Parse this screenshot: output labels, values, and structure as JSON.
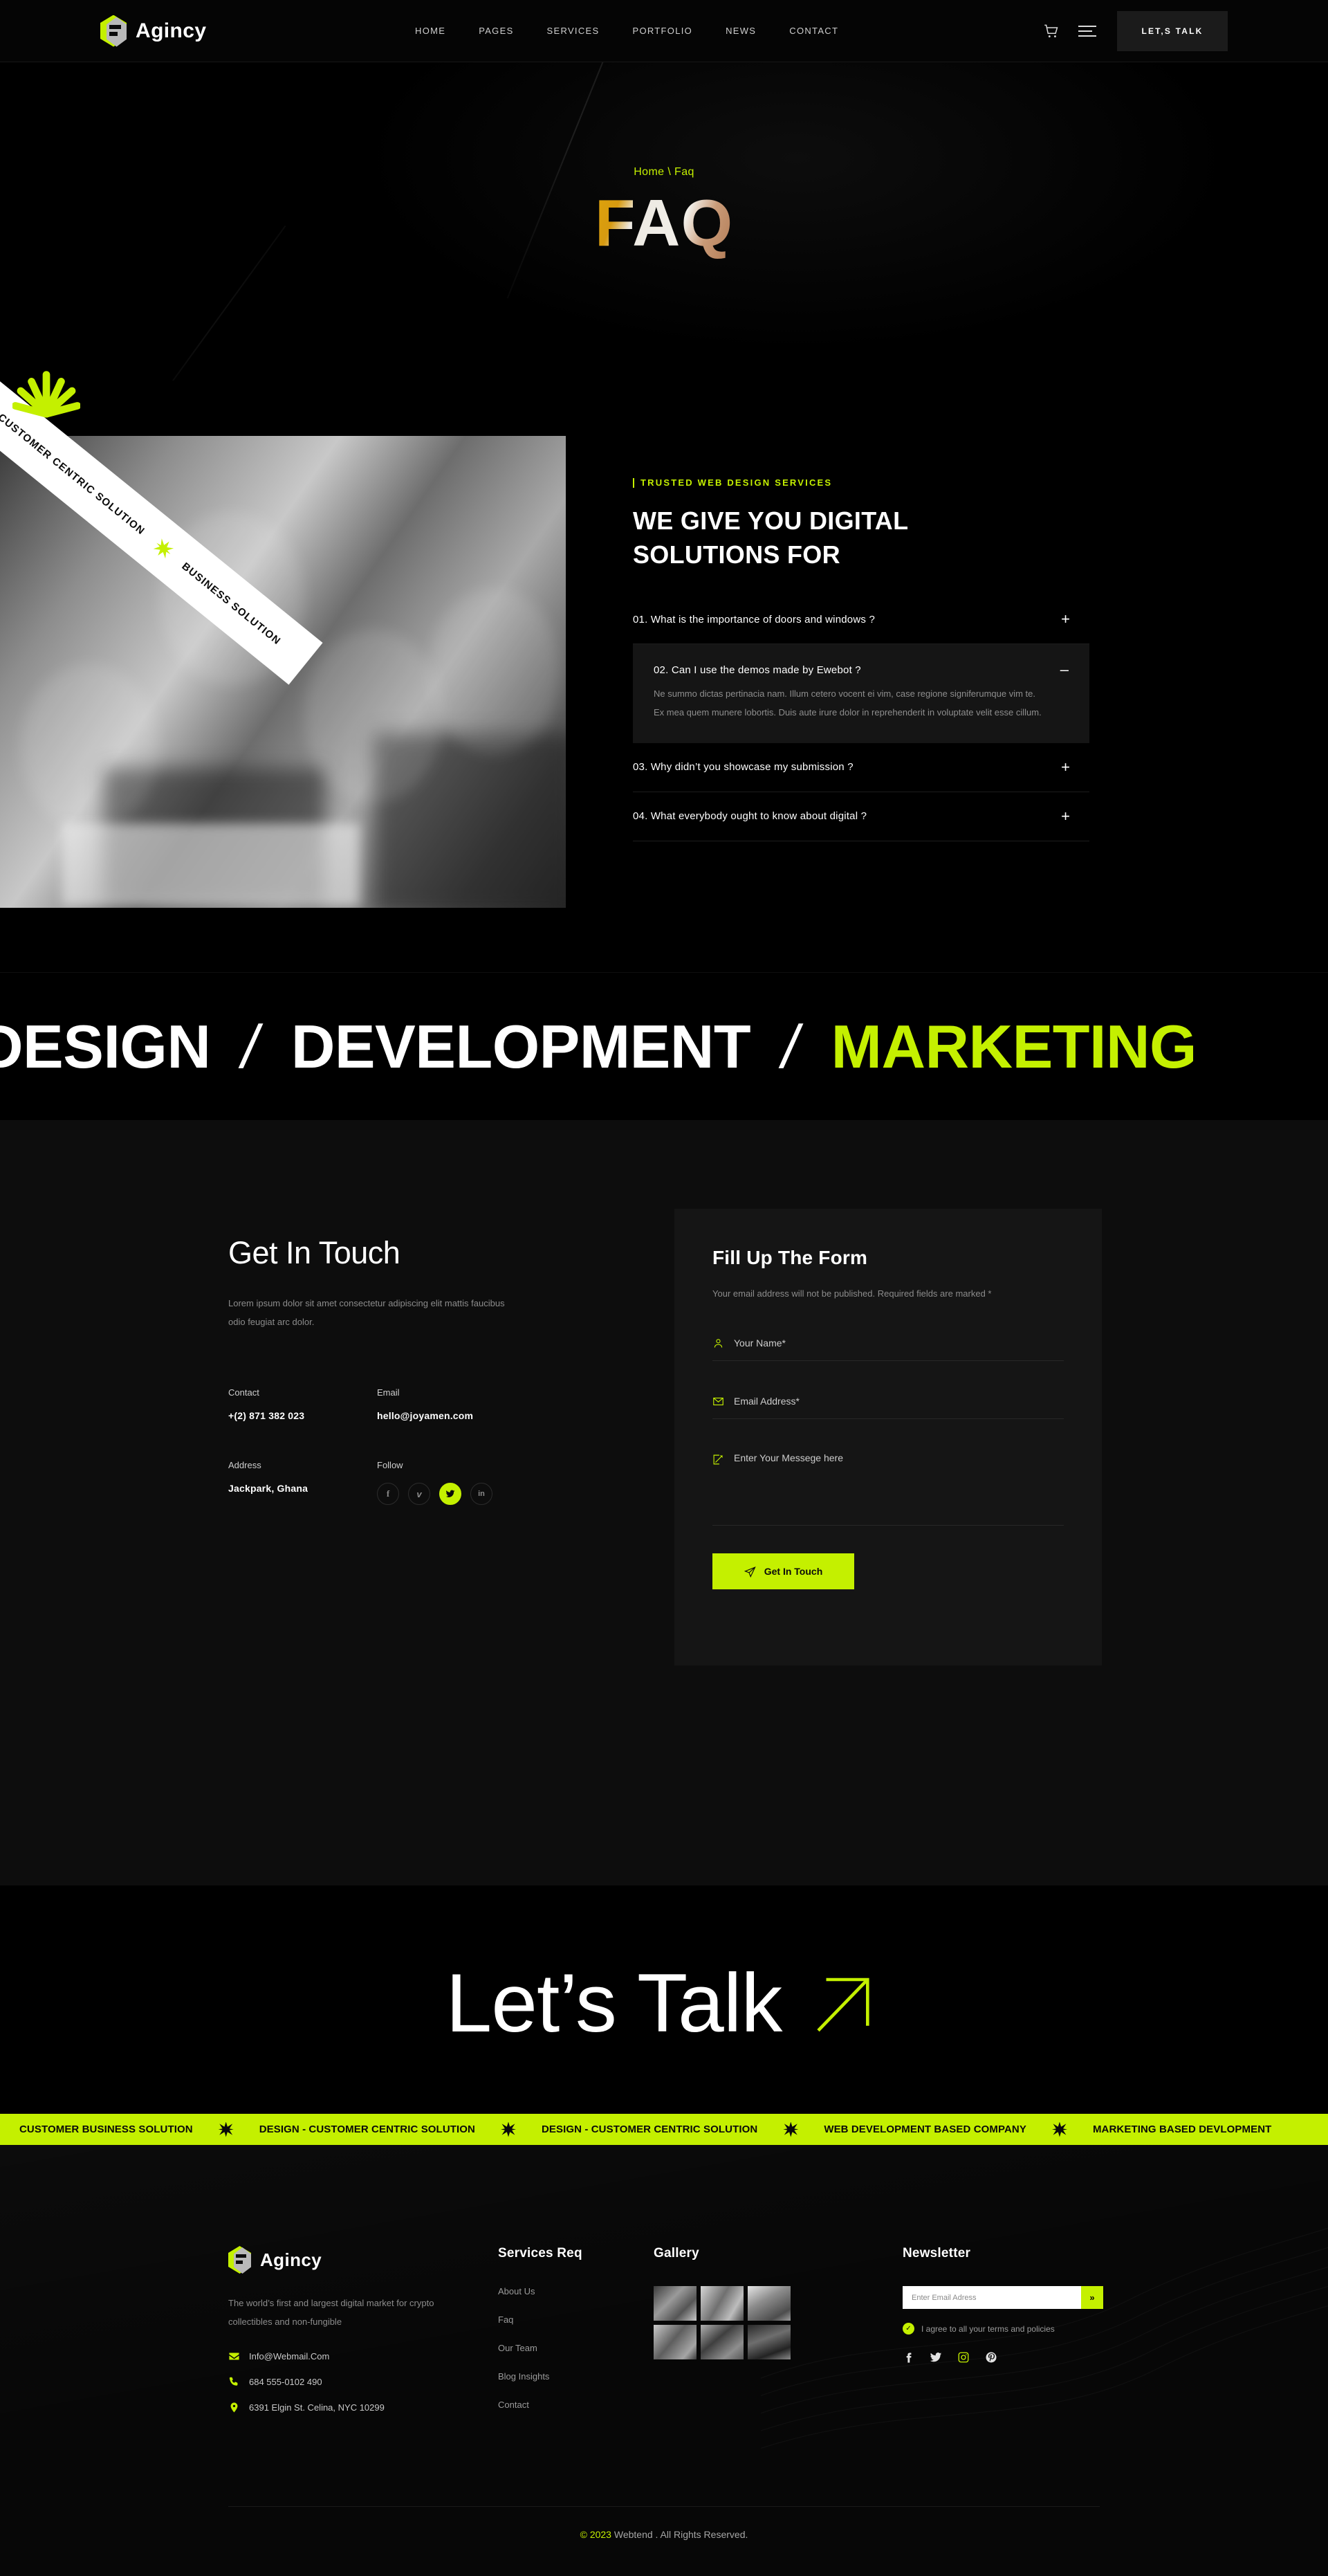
{
  "header": {
    "brand": "Agincy",
    "nav": [
      "HOME",
      "PAGES",
      "SERVICES",
      "PORTFOLIO",
      "NEWS",
      "CONTACT"
    ],
    "cart_icon": "shopping-cart-icon",
    "menu_icon": "hamburger-menu-icon",
    "cta": "LET,S TALK"
  },
  "hero": {
    "breadcrumb": "Home \\ Faq",
    "title": "FAQ"
  },
  "faq": {
    "ribbon_text_1": "DESIGN - CUSTOMER CENTRIC SOLUTION",
    "ribbon_text_2": "BUSINESS SOLUTION",
    "eyebrow": "TRUSTED WEB DESIGN SERVICES",
    "heading_line1": "WE GIVE YOU DIGITAL",
    "heading_line2": "SOLUTIONS FOR",
    "items": [
      {
        "q": "01. What is the importance of doors and windows ?",
        "sign": "+",
        "open": false,
        "a": ""
      },
      {
        "q": "02. Can I use the demos made by Ewebot ?",
        "sign": "–",
        "open": true,
        "a": "Ne summo dictas pertinacia nam. Illum cetero vocent ei vim, case regione signiferumque vim te. Ex mea quem munere lobortis. Duis aute irure dolor in reprehenderit in voluptate velit esse cillum."
      },
      {
        "q": "03. Why didn’t you showcase my submission ?",
        "sign": "+",
        "open": false,
        "a": ""
      },
      {
        "q": "04. What everybody ought to know about digital ?",
        "sign": "+",
        "open": false,
        "a": ""
      }
    ]
  },
  "marquee": {
    "words": [
      "DESIGN",
      "/",
      "DEVELOPMENT",
      "/",
      "MARKETING"
    ],
    "highlight_color": "#c4f000"
  },
  "contact": {
    "title": "Get In Touch",
    "subtitle": "Lorem ipsum dolor sit amet consectetur adipiscing elit mattis faucibus odio feugiat arc dolor.",
    "contact_label": "Contact",
    "contact_value": "+(2) 871 382 023",
    "email_label": "Email",
    "email_value": "hello@joyamen.com",
    "address_label": "Address",
    "address_value": "Jackpark, Ghana",
    "follow_label": "Follow",
    "socials": [
      {
        "name": "facebook-icon",
        "glyph": "f",
        "active": false
      },
      {
        "name": "vimeo-icon",
        "glyph": "v",
        "active": false
      },
      {
        "name": "twitter-icon",
        "glyph": "t",
        "active": true
      },
      {
        "name": "linkedin-icon",
        "glyph": "in",
        "active": false
      }
    ]
  },
  "form": {
    "title": "Fill Up The Form",
    "note": "Your email address will not be published. Required fields are marked *",
    "name_placeholder": "Your Name*",
    "email_placeholder": "Email Address*",
    "message_placeholder": "Enter Your Messege here",
    "name_icon": "user-icon",
    "email_icon": "envelope-icon",
    "message_icon": "pencil-edit-icon",
    "submit_label": "Get In Touch",
    "submit_icon": "paper-plane-icon",
    "accent": "#c4f000"
  },
  "lets_talk": {
    "text": "Let’s Talk",
    "arrow_icon": "arrow-up-right-icon"
  },
  "ticker": {
    "bg": "#c4f000",
    "items": [
      "CUSTOMER BUSINESS SOLUTION",
      "DESIGN - CUSTOMER CENTRIC SOLUTION",
      "DESIGN - CUSTOMER CENTRIC SOLUTION",
      "WEB DEVELOPMENT BASED COMPANY",
      "MARKETING BASED DEVLOPMENT"
    ]
  },
  "footer": {
    "brand": "Agincy",
    "description": "The world’s first and largest digital market for crypto collectibles and non-fungible",
    "contacts": [
      {
        "icon": "envelope-icon",
        "text": "Info@Webmail.Com"
      },
      {
        "icon": "phone-icon",
        "text": "684 555-0102 490"
      },
      {
        "icon": "map-pin-icon",
        "text": "6391 Elgin St. Celina, NYC 10299"
      }
    ],
    "links_title": "Services Req",
    "links": [
      "About Us",
      "Faq",
      "Our Team",
      "Blog Insights",
      "Contact"
    ],
    "gallery_title": "Gallery",
    "gallery_count": 6,
    "newsletter_title": "Newsletter",
    "newsletter_placeholder": "Enter Email Adress",
    "newsletter_btn": "»",
    "agree_text": "I agree to all your terms and policies",
    "socials": [
      {
        "name": "facebook-icon",
        "glyph": "f"
      },
      {
        "name": "twitter-icon",
        "glyph": "t"
      },
      {
        "name": "instagram-icon",
        "glyph": "ig"
      },
      {
        "name": "pinterest-icon",
        "glyph": "p"
      }
    ],
    "copyright_year": "© 2023",
    "copyright_text": " Webtend . All Rights Reserved."
  }
}
